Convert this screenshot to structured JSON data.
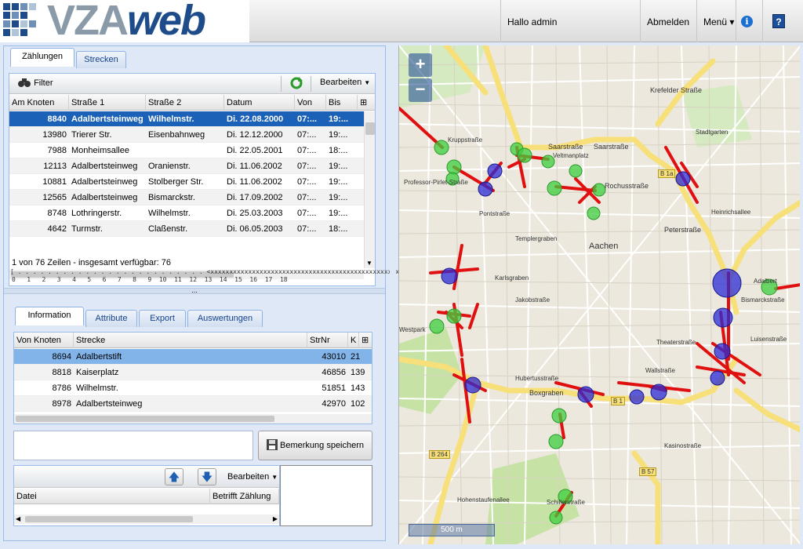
{
  "header": {
    "logo_vza": "VZA",
    "logo_web": "web",
    "greeting": "Hallo admin",
    "logout": "Abmelden",
    "menu": "Menü ▾",
    "info_icon": "i",
    "help_icon": "?"
  },
  "top_tabs": [
    "Zählungen",
    "Strecken"
  ],
  "count_grid": {
    "filter_label": "Filter",
    "edit_label": "Bearbeiten",
    "columns": [
      "Am Knoten",
      "Straße 1",
      "Straße 2",
      "Datum",
      "Von",
      "Bis"
    ],
    "rows": [
      [
        "8840",
        "Adalbertsteinweg",
        "Wilhelmstr.",
        "Di. 22.08.2000",
        "07:...",
        "19:..."
      ],
      [
        "13980",
        "Trierer Str.",
        "Eisenbahnweg",
        "Di. 12.12.2000",
        "07:...",
        "19:..."
      ],
      [
        "7988",
        "Monheimsallee",
        "",
        "Di. 22.05.2001",
        "07:...",
        "18:..."
      ],
      [
        "12113",
        "Adalbertsteinweg",
        "Oranienstr.",
        "Di. 11.06.2002",
        "07:...",
        "19:..."
      ],
      [
        "10881",
        "Adalbertsteinweg",
        "Stolberger Str.",
        "Di. 11.06.2002",
        "07:...",
        "19:..."
      ],
      [
        "12565",
        "Adalbertsteinweg",
        "Bismarckstr.",
        "Di. 17.09.2002",
        "07:...",
        "19:..."
      ],
      [
        "8748",
        "Lothringerstr.",
        "Wilhelmstr.",
        "Di. 25.03.2003",
        "07:...",
        "19:..."
      ],
      [
        "4642",
        "Turmstr.",
        "Claßenstr.",
        "Di. 06.05.2003",
        "07:...",
        "18:..."
      ]
    ],
    "status": "1 von 76 Zeilen - insgesamt verfügbar: 76",
    "ruler_top": "[ . . . . . . . . . . . . . . . . . . . . . . . . . <xxxxxxxxxxxxxxxxxxxxxxxxxxxxxxxxxxxxxxxxxxxxxxxxxxxx]",
    "ruler_nums": "0   1   2   3   4   5   6   7   8   9  10  11  12  13  14  15  16  17  18"
  },
  "splitter_label": "...",
  "bottom_tabs": [
    "Information",
    "Attribute",
    "Export",
    "Auswertungen"
  ],
  "info_grid": {
    "columns": [
      "Von Knoten",
      "Strecke",
      "StrNr",
      "K"
    ],
    "rows": [
      [
        "8694",
        "Adalbertstift",
        "43010",
        "21"
      ],
      [
        "8818",
        "Kaiserplatz",
        "46856",
        "139"
      ],
      [
        "8786",
        "Wilhelmstr.",
        "51851",
        "143"
      ],
      [
        "8978",
        "Adalbertsteinweg",
        "42970",
        "102"
      ]
    ]
  },
  "save_remark": "Bemerkung speichern",
  "file_grid": {
    "edit_label": "Bearbeiten",
    "columns": [
      "Datei",
      "Betrifft Zählung"
    ]
  },
  "map": {
    "zoom_in": "+",
    "zoom_out": "−",
    "scale": "500 m",
    "labels": [
      "Aachen",
      "Saarstraße",
      "Saarstraße",
      "Veltmanplatz",
      "Rochusstraße",
      "Krefelder Straße",
      "Stadtgarten",
      "Peterstraße",
      "Heinrichsallee",
      "Templergraben",
      "Pontstraße",
      "Karlsgraben",
      "Jakobstraße",
      "Boxgraben",
      "Hubertusstraße",
      "Wallstraße",
      "Theaterstraße",
      "Bismarckstraße",
      "Luisenstraße",
      "Westpark",
      "Kasinostraße",
      "Hohenstaufenallee",
      "Schillerstraße",
      "B 57",
      "B 1a",
      "B 1",
      "B 264",
      "Krupp­straße",
      "Adalbert",
      "Professor-Pirlet-Straße"
    ]
  },
  "colors": {
    "selection": "#1c61b8",
    "selection_light": "#82b4ea",
    "panel": "#dfe8f6",
    "marker_green": "#3ecf3e",
    "marker_blue": "#2b2bd6",
    "marker_red": "#e01010"
  }
}
